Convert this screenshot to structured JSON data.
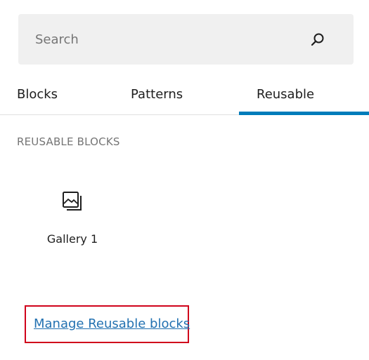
{
  "search": {
    "placeholder": "Search",
    "value": "",
    "icon": "search-icon"
  },
  "tabs": [
    {
      "label": "Blocks",
      "active": false
    },
    {
      "label": "Patterns",
      "active": false
    },
    {
      "label": "Reusable",
      "active": true
    }
  ],
  "reusable": {
    "heading": "REUSABLE BLOCKS",
    "items": [
      {
        "label": "Gallery 1",
        "icon": "gallery-icon"
      }
    ],
    "manage_link": "Manage Reusable blocks"
  },
  "colors": {
    "accent": "#007cba",
    "link": "#2271b1",
    "highlight": "#d0021b",
    "search_bg": "#f0f0f0"
  }
}
